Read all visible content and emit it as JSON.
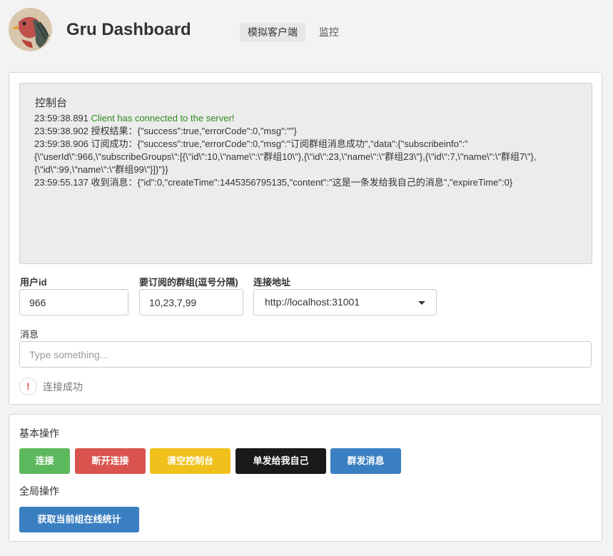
{
  "header": {
    "title": "Gru Dashboard",
    "tabs": [
      {
        "label": "模拟客户端",
        "active": true
      },
      {
        "label": "监控",
        "active": false
      }
    ]
  },
  "console": {
    "title": "控制台",
    "lines": [
      {
        "time": "23:59:38.891",
        "text": "Client has connected to the server!",
        "color": "#2e8b1e"
      },
      {
        "time": "23:59:38.902",
        "text": "授权结果：{\"success\":true,\"errorCode\":0,\"msg\":\"\"}"
      },
      {
        "time": "23:59:38.906",
        "text": "订阅成功：{\"success\":true,\"errorCode\":0,\"msg\":\"订阅群组消息成功\",\"data\":{\"subscribeinfo\":\"{\\\"userId\\\":966,\\\"subscribeGroups\\\":[{\\\"id\\\":10,\\\"name\\\":\\\"群组10\\\"},{\\\"id\\\":23,\\\"name\\\":\\\"群组23\\\"},{\\\"id\\\":7,\\\"name\\\":\\\"群组7\\\"},{\\\"id\\\":99,\\\"name\\\":\\\"群组99\\\"}]}\"}}"
      },
      {
        "time": "23:59:55.137",
        "text": "收到消息：{\"id\":0,\"createTime\":1445356795135,\"content\":\"这是一条发给我自己的消息\",\"expireTime\":0}"
      }
    ]
  },
  "form": {
    "user_id_label": "用户id",
    "user_id_value": "966",
    "groups_label": "要订阅的群组(逗号分隔)",
    "groups_value": "10,23,7,99",
    "address_label": "连接地址",
    "address_value": "http://localhost:31001",
    "message_label": "消息",
    "message_placeholder": "Type something..."
  },
  "status": {
    "icon": "!",
    "text": "连接成功"
  },
  "basic_ops": {
    "title": "基本操作",
    "buttons": [
      {
        "label": "连接",
        "color": "#5cb85c"
      },
      {
        "label": "断开连接",
        "color": "#d9534f"
      },
      {
        "label": "清空控制台",
        "color": "#f0c11c"
      },
      {
        "label": "单发给我自己",
        "color": "#1a1a1a"
      },
      {
        "label": "群发消息",
        "color": "#3a7fc1"
      }
    ]
  },
  "global_ops": {
    "title": "全局操作",
    "buttons": [
      {
        "label": "获取当前组在线统计",
        "color": "#3a7fc1"
      }
    ]
  }
}
